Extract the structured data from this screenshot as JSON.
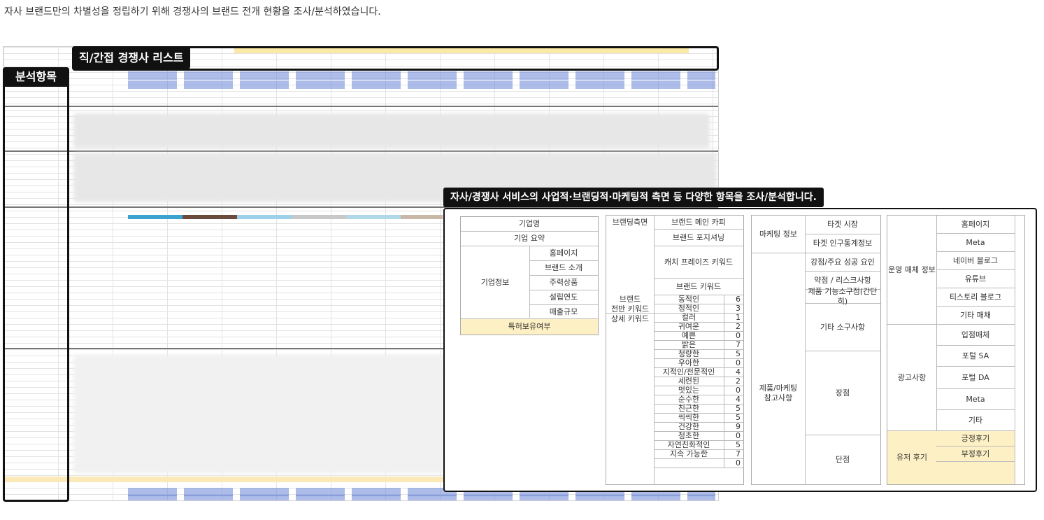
{
  "intro": "자사 브랜드만의 차별성을 정립하기 위해 경쟁사의 브랜드 전개 현황을 조사/분석하였습니다.",
  "labels": {
    "competitor_list": "직/간접 경쟁사 리스트",
    "analysis_items": "분석항목",
    "callout": "자사/경쟁사 서비스의 사업적·브랜딩적·마케팅적 측면 등 다양한 항목을 조사/분석합니다."
  },
  "table1": {
    "rows": [
      "기업명",
      "기업 요약"
    ],
    "group": "기업정보",
    "group_items": [
      "홈페이지",
      "브랜드 소개",
      "주력상품",
      "설립연도",
      "매출규모"
    ],
    "patent": "특허보유여부"
  },
  "table2": {
    "branding": "브랜딩측면",
    "branding_items": [
      "브랜드 메인 카피",
      "브랜드 포지셔닝",
      "캐치 프레이즈 키워드",
      "브랜드 키워드"
    ],
    "brand_kw_group": "브랜드\n전반 키워드",
    "brand_kw": [
      {
        "name": "동적인",
        "n": "6"
      },
      {
        "name": "정적인",
        "n": "3"
      }
    ],
    "detail_group": "상세 키워드",
    "detail_kw": [
      {
        "name": "컬러",
        "n": "1"
      },
      {
        "name": "귀여운",
        "n": "2"
      },
      {
        "name": "예쁜",
        "n": "0"
      },
      {
        "name": "밝은",
        "n": "7"
      },
      {
        "name": "청량한",
        "n": "5"
      },
      {
        "name": "우아한",
        "n": "0"
      },
      {
        "name": "지적인/전문적인",
        "n": "4"
      },
      {
        "name": "세련된",
        "n": "2"
      },
      {
        "name": "멋있는",
        "n": "0"
      },
      {
        "name": "순수한",
        "n": "4"
      },
      {
        "name": "친근한",
        "n": "5"
      },
      {
        "name": "씩씩한",
        "n": "5"
      },
      {
        "name": "건강한",
        "n": "9"
      },
      {
        "name": "청초한",
        "n": "0"
      },
      {
        "name": "자연친화적인",
        "n": "5"
      },
      {
        "name": "지속 가능한",
        "n": "7"
      },
      {
        "name": "",
        "n": "0"
      }
    ]
  },
  "table3": {
    "marketing": "마케팅 정보",
    "marketing_items": [
      "타겟 시장",
      "타겟 인구통계정보"
    ],
    "strengths": [
      "강점/주요 성공 요인",
      "약점 / 리스크사항",
      "제품 기능소구점(간단히)",
      "기타 소구사항"
    ],
    "ref_group": "제품/마케팅\n참고사항",
    "pros": "장점",
    "cons": "단점"
  },
  "table4": {
    "media_group": "운영 매체 정보",
    "media": [
      "홈페이지",
      "Meta",
      "네이버 블로그",
      "유튜브",
      "티스토리 블로그",
      "기타 매채"
    ],
    "ad_group": "광고사항",
    "ads": [
      "입점매체",
      "포털 SA",
      "포털 DA",
      "Meta",
      "기타"
    ],
    "review_group": "유저 후기",
    "reviews": [
      "긍정후기",
      "부정후기"
    ]
  }
}
